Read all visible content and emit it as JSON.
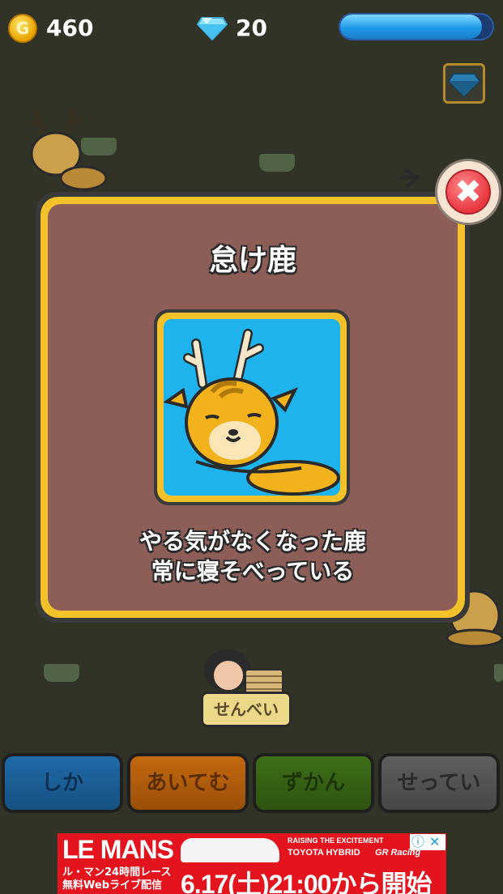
{
  "hud": {
    "coin_icon_label": "G",
    "coins": "460",
    "gems": "20",
    "energy_level": 0.93
  },
  "modal": {
    "title": "怠け鹿",
    "description_line1": "やる気がなくなった鹿",
    "description_line2": "常に寝そべっている"
  },
  "scene": {
    "vendor_sign": "せんべい"
  },
  "tabs": [
    {
      "label": "しか"
    },
    {
      "label": "あいてむ"
    },
    {
      "label": "ずかん"
    },
    {
      "label": "せってい"
    }
  ],
  "ad": {
    "logo": "LE MANS",
    "tagline1": "RAISING THE EXCITEMENT",
    "tagline2": "TOYOTA HYBRID",
    "brand": "GR Racing",
    "sub_line1": "ル・マン24時間レース",
    "sub_line2": "無料Webライブ配信",
    "date": "6.17(土)21:00から開始"
  },
  "colors": {
    "background": "#323327",
    "modal_body": "#8d5e58",
    "modal_border": "#f3c12a",
    "portrait_bg": "#1fb3ee",
    "close_button": "#e8363f",
    "ad_red": "#e3141e"
  },
  "icons": [
    "gold-coin-icon",
    "diamond-icon",
    "energy-bar",
    "diamond-shop-icon",
    "close-icon",
    "lazy-deer-portrait"
  ]
}
